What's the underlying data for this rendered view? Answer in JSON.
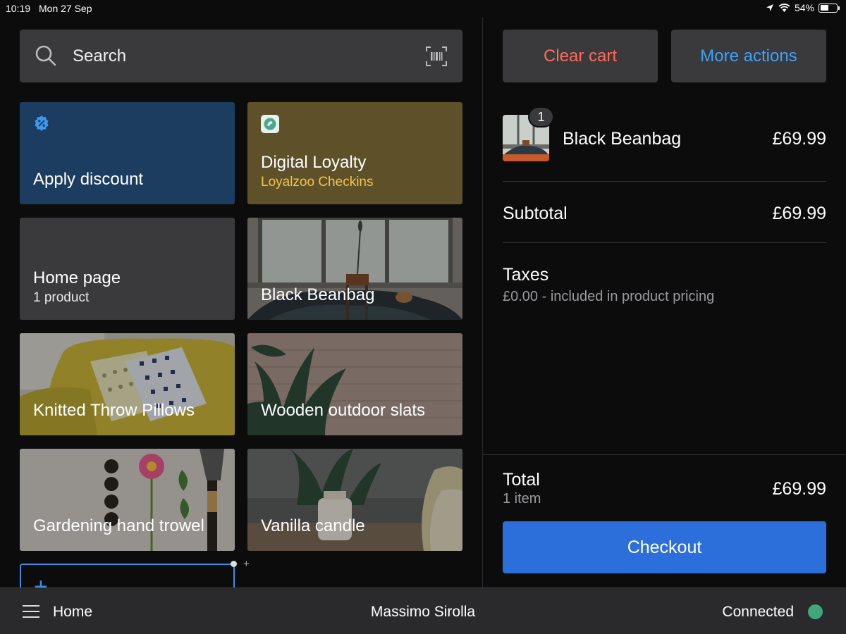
{
  "status_bar": {
    "time": "10:19",
    "date": "Mon 27 Sep",
    "battery": "54%",
    "battery_level": 0.54
  },
  "search": {
    "placeholder": "Search",
    "search_icon": "search-icon",
    "scan_icon": "barcode-scan-icon"
  },
  "tiles": [
    {
      "title": "Apply discount",
      "icon": "discount-badge-icon",
      "color": "#1c3d60"
    },
    {
      "title": "Digital Loyalty",
      "subtitle": "Loyalzoo Checkins",
      "subtitle_color": "#f5c34a",
      "icon": "loyalzoo-app-icon",
      "color": "#5e512a"
    },
    {
      "title": "Home page",
      "subtitle": "1 product",
      "color": "#3a3a3c"
    },
    {
      "title": "Black Beanbag"
    },
    {
      "title": "Knitted Throw Pillows"
    },
    {
      "title": "Wooden outdoor slats"
    },
    {
      "title": "Gardening hand trowel"
    },
    {
      "title": "Vanilla candle"
    }
  ],
  "new_tile_icon": "plus-icon",
  "pager": {
    "add_icon": "+"
  },
  "actions": {
    "clear_cart": "Clear cart",
    "more_actions": "More actions",
    "clear_color": "#ff6a5c",
    "more_color": "#3fa1f5"
  },
  "cart": {
    "items": [
      {
        "quantity": "1",
        "name": "Black Beanbag",
        "price": "£69.99"
      }
    ],
    "subtotal_label": "Subtotal",
    "subtotal_value": "£69.99",
    "taxes_label": "Taxes",
    "taxes_note": "£0.00 - included in product pricing",
    "total_label": "Total",
    "total_count": "1 item",
    "total_value": "£69.99",
    "checkout_label": "Checkout",
    "checkout_color": "#2c6fda"
  },
  "bottom_bar": {
    "menu_icon": "hamburger-menu-icon",
    "home_label": "Home",
    "user_name": "Massimo Sirolla",
    "connection_label": "Connected",
    "connection_color": "#3ea87a"
  }
}
